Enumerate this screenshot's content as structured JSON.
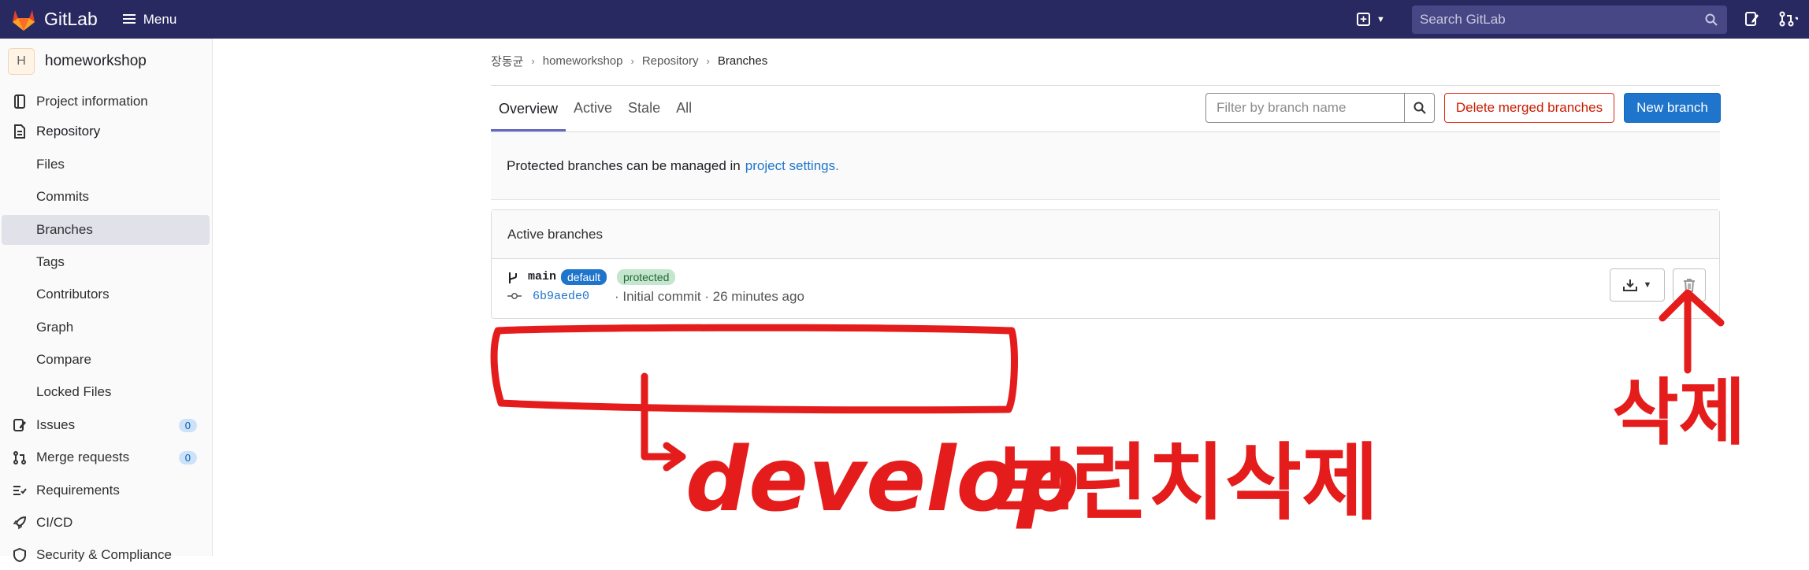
{
  "topbar": {
    "brand": "GitLab",
    "menu_label": "Menu",
    "search_placeholder": "Search GitLab",
    "bg_color": "#292961"
  },
  "sidebar": {
    "project_initial": "H",
    "project_name": "homeworkshop",
    "items": [
      {
        "label": "Project information",
        "icon": "book-icon"
      },
      {
        "label": "Repository",
        "icon": "doc-icon"
      },
      {
        "label": "Files"
      },
      {
        "label": "Commits"
      },
      {
        "label": "Branches",
        "selected": true
      },
      {
        "label": "Tags"
      },
      {
        "label": "Contributors"
      },
      {
        "label": "Graph"
      },
      {
        "label": "Compare"
      },
      {
        "label": "Locked Files"
      },
      {
        "label": "Issues",
        "icon": "issues-icon",
        "count": "0"
      },
      {
        "label": "Merge requests",
        "icon": "merge-request-icon",
        "count": "0"
      },
      {
        "label": "Requirements",
        "icon": "requirements-icon"
      },
      {
        "label": "CI/CD",
        "icon": "rocket-icon"
      },
      {
        "label": "Security & Compliance",
        "icon": "shield-icon"
      }
    ]
  },
  "breadcrumb": [
    "장동균",
    "homeworkshop",
    "Repository",
    "Branches"
  ],
  "tabs": [
    "Overview",
    "Active",
    "Stale",
    "All"
  ],
  "filter_placeholder": "Filter by branch name",
  "buttons": {
    "delete_merged": "Delete merged branches",
    "new_branch": "New branch"
  },
  "info": {
    "text": "Protected branches can be managed in",
    "link": "project settings."
  },
  "panel": {
    "title": "Active branches",
    "branch": {
      "name": "main",
      "badge_default": "default",
      "badge_protected": "protected",
      "commit_sha": "6b9aede0",
      "commit_msg": "· Initial commit · 26 minutes ago"
    }
  },
  "annotations": {
    "text_develop": "develop",
    "text_branch_delete": "브런치삭제",
    "text_delete": "삭제",
    "color": "#e51c1c"
  }
}
